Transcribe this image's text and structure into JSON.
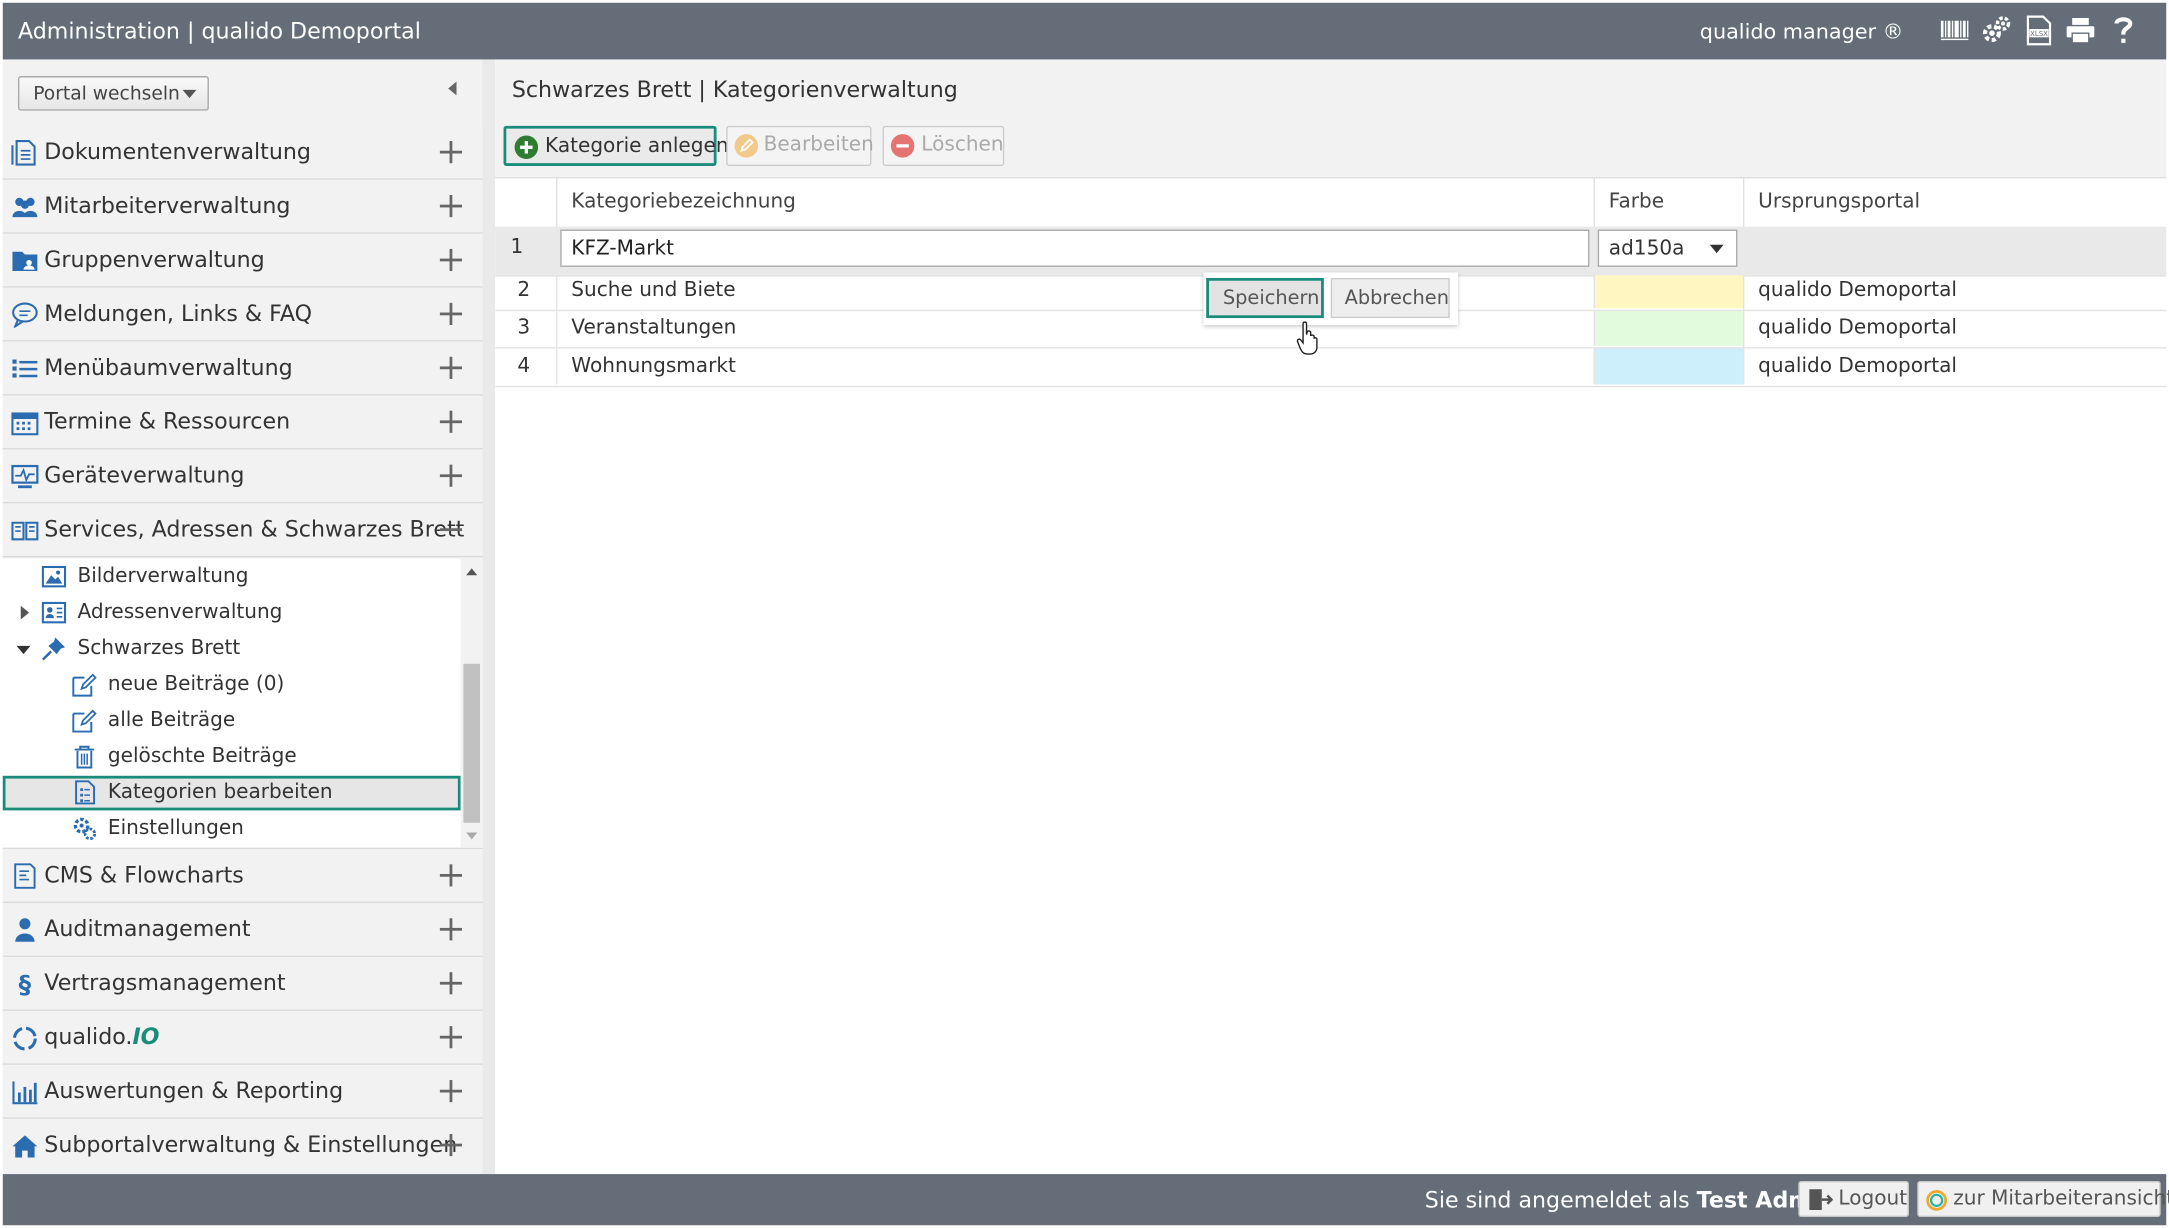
{
  "header": {
    "title": "Administration | qualido Demoportal",
    "brand": "qualido manager ®",
    "icons": [
      "barcode-icon",
      "gears-icon",
      "xlsx-icon",
      "print-icon",
      "help-icon"
    ]
  },
  "sidebar": {
    "portal_select": "Portal wechseln",
    "items_top": [
      {
        "label": "Dokumentenverwaltung",
        "icon": "document-icon"
      },
      {
        "label": "Mitarbeiterverwaltung",
        "icon": "users-icon"
      },
      {
        "label": "Gruppenverwaltung",
        "icon": "group-folder-icon"
      },
      {
        "label": "Meldungen, Links & FAQ",
        "icon": "chat-icon"
      },
      {
        "label": "Menübaumverwaltung",
        "icon": "list-icon"
      },
      {
        "label": "Termine & Ressourcen",
        "icon": "calendar-icon"
      },
      {
        "label": "Geräteverwaltung",
        "icon": "monitor-icon"
      },
      {
        "label": "Services, Adressen & Schwarzes Brett",
        "icon": "book-icon"
      }
    ],
    "subtree": [
      {
        "label": "Bilderverwaltung",
        "icon": "image-icon",
        "level": 1
      },
      {
        "label": "Adressenverwaltung",
        "icon": "address-card-icon",
        "level": 1,
        "toggle": "collapsed"
      },
      {
        "label": "Schwarzes Brett",
        "icon": "pin-icon",
        "level": 1,
        "toggle": "expanded"
      },
      {
        "label": "neue Beiträge (0)",
        "icon": "edit-note-icon",
        "level": 2
      },
      {
        "label": "alle Beiträge",
        "icon": "edit-note-icon",
        "level": 2
      },
      {
        "label": "gelöschte Beiträge",
        "icon": "trash-icon",
        "level": 2
      },
      {
        "label": "Kategorien bearbeiten",
        "icon": "category-list-icon",
        "level": 2,
        "selected": true
      },
      {
        "label": "Einstellungen",
        "icon": "settings-icon",
        "level": 2
      }
    ],
    "items_bottom": [
      {
        "label": "CMS & Flowcharts",
        "icon": "flowchart-icon"
      },
      {
        "label": "Auditmanagement",
        "icon": "auditor-icon"
      },
      {
        "label": "Vertragsmanagement",
        "icon": "paragraph-icon"
      },
      {
        "label_main": "qualido.",
        "label_accent": "IO",
        "icon": "qualido-io-icon"
      },
      {
        "label": "Auswertungen & Reporting",
        "icon": "bar-chart-icon"
      },
      {
        "label": "Subportalverwaltung & Einstellungen",
        "icon": "home-icon"
      }
    ]
  },
  "main": {
    "breadcrumb": "Schwarzes Brett | Kategorienverwaltung",
    "toolbar": {
      "add": "Kategorie anlegen",
      "edit": "Bearbeiten",
      "delete": "Löschen"
    },
    "grid": {
      "columns": [
        "Kategoriebezeichnung",
        "Farbe",
        "Ursprungsportal"
      ],
      "edit_row": {
        "num": "1",
        "name": "KFZ-Markt",
        "color": "ad150a"
      },
      "rows": [
        {
          "num": "2",
          "name": "Suche und Biete",
          "color": "#fff6c2",
          "portal": "qualido Demoportal"
        },
        {
          "num": "3",
          "name": "Veranstaltungen",
          "color": "#e2fbdc",
          "portal": "qualido Demoportal"
        },
        {
          "num": "4",
          "name": "Wohnungsmarkt",
          "color": "#cdeffb",
          "portal": "qualido Demoportal"
        }
      ]
    },
    "popup": {
      "save": "Speichern",
      "cancel": "Abbrechen"
    }
  },
  "footer": {
    "login_prefix": "Sie sind angemeldet als ",
    "user": "Test Admin",
    "logout": "Logout",
    "employee_view": "zur Mitarbeiteransicht"
  },
  "colors": {
    "header_bg": "#646d78",
    "accent_teal": "#1a8c7a",
    "add_green": "#2e7d32",
    "delete_red": "#e57373",
    "edit_orange": "#f2c98a"
  }
}
